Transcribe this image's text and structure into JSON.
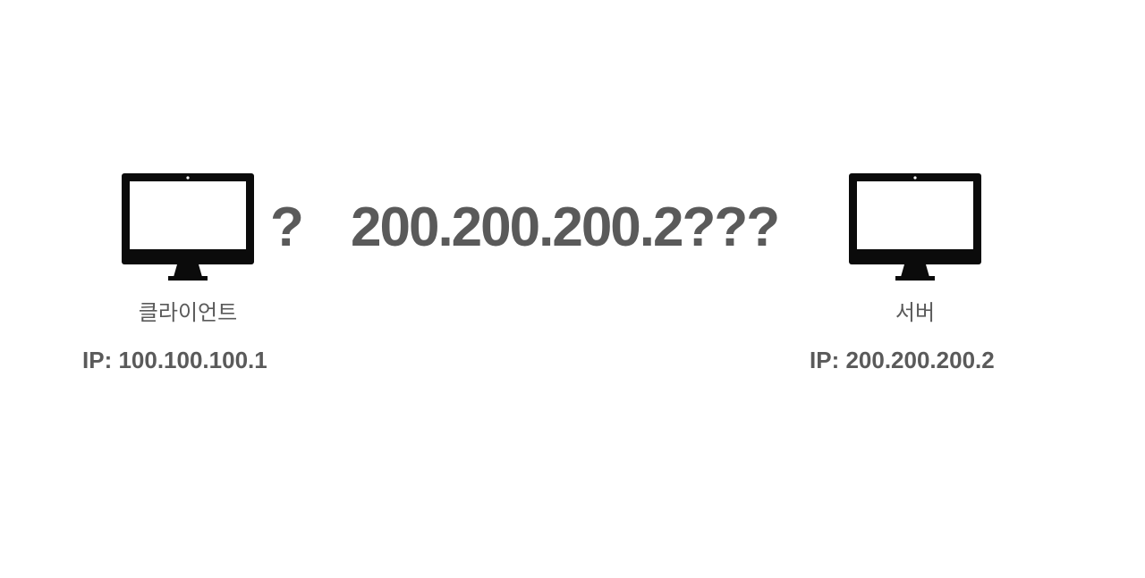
{
  "client": {
    "label": "클라이언트",
    "ip": "IP: 100.100.100.1"
  },
  "server": {
    "label": "서버",
    "ip": "IP: 200.200.200.2"
  },
  "question": {
    "mark": "?",
    "target": "200.200.200.2???"
  },
  "colors": {
    "text": "#5a5a5a",
    "monitor": "#0b0b0b",
    "background": "#ffffff"
  }
}
